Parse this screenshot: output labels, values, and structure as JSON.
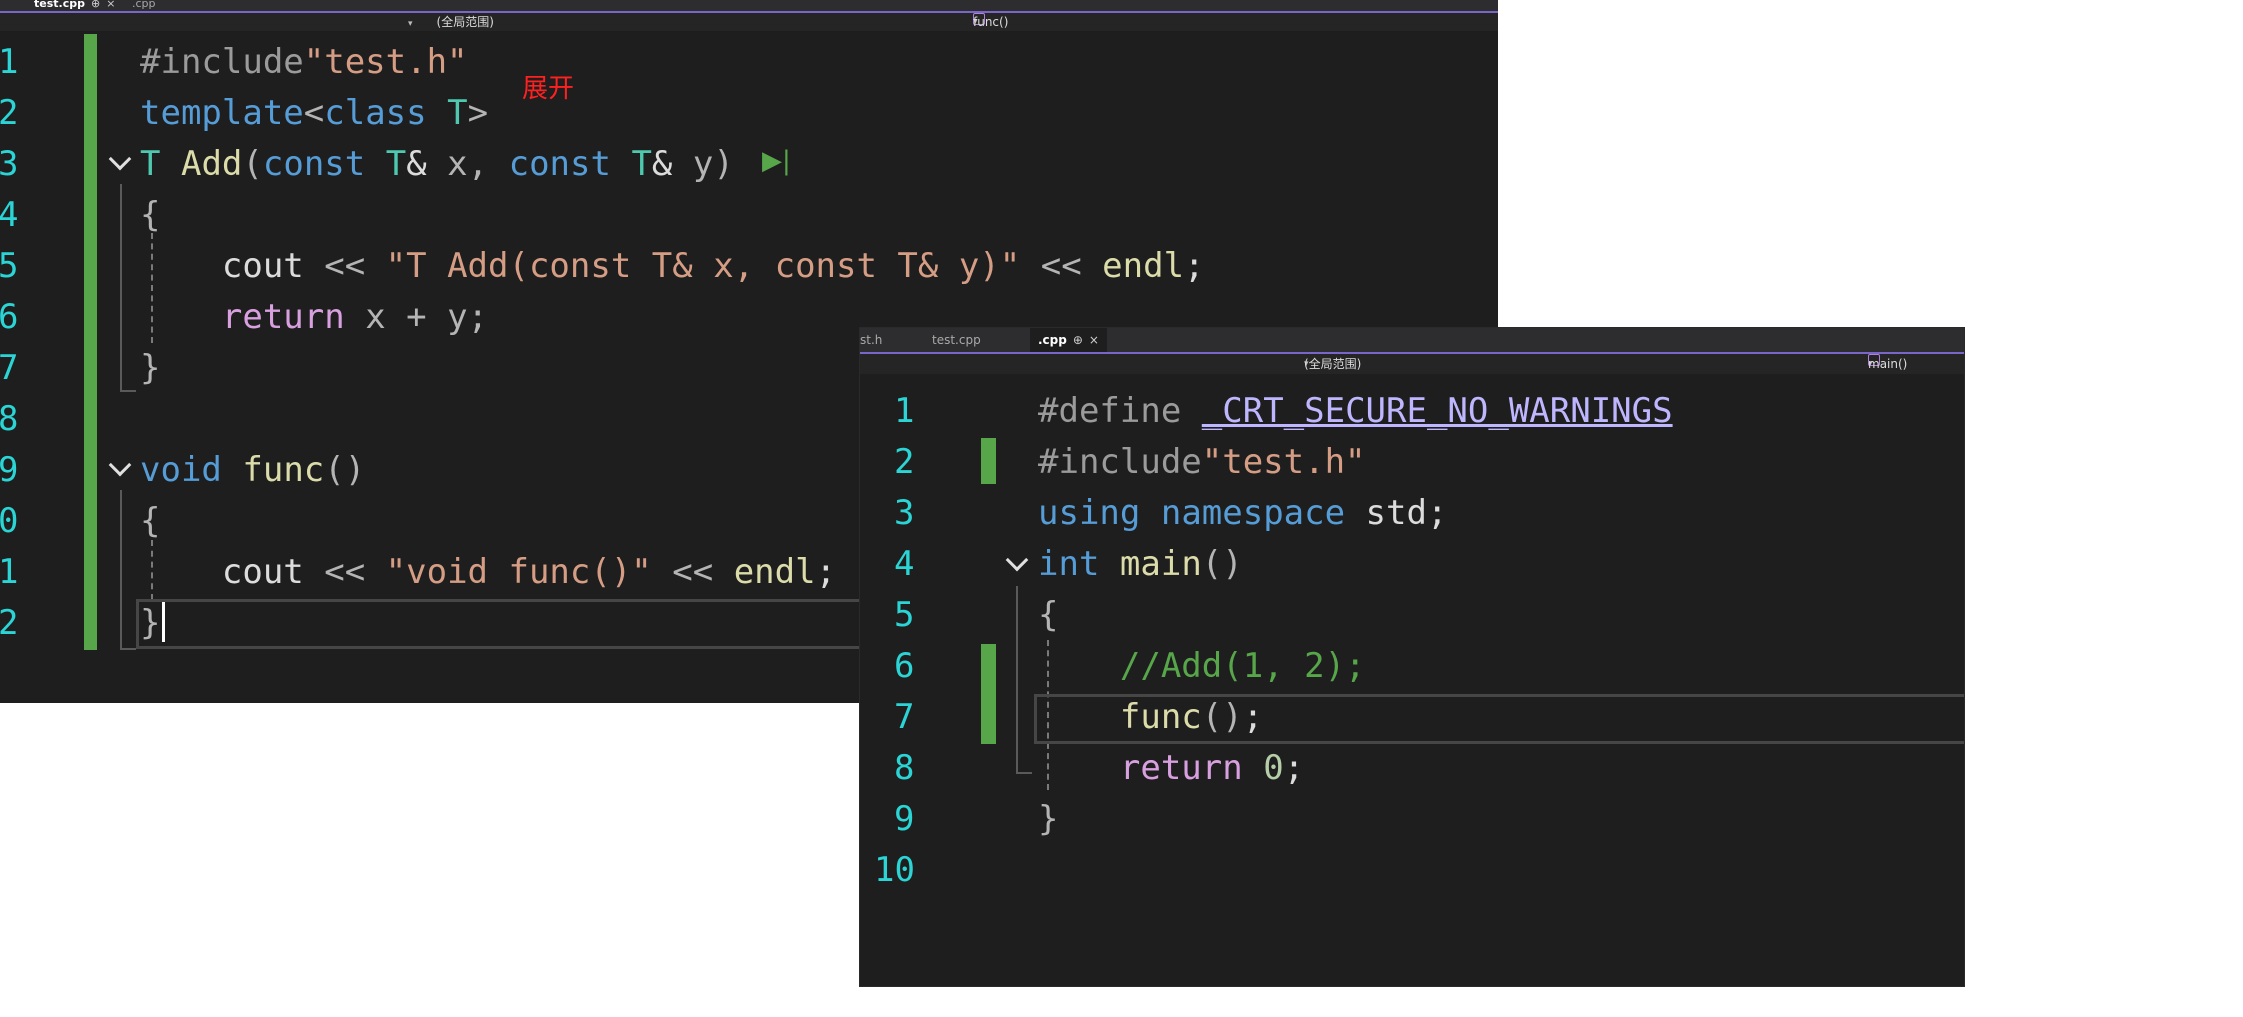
{
  "window1": {
    "tabs": [
      "test.cpp",
      ".cpp"
    ],
    "scope": "(全局范围)",
    "member": "func()",
    "annotation": "展开",
    "line_numbers": [
      "1",
      "2",
      "3",
      "4",
      "5",
      "6",
      "7",
      "8",
      "9",
      "0",
      "1",
      "2"
    ]
  },
  "window2": {
    "tabs": [
      "st.h",
      "test.cpp",
      ".cpp"
    ],
    "scope": "(全局范围)",
    "member": "main()",
    "line_numbers": [
      "1",
      "2",
      "3",
      "4",
      "5",
      "6",
      "7",
      "8",
      "9",
      "10"
    ]
  },
  "colors": {
    "editor_bg": "#1e1e1e",
    "keyword": "#569cd6",
    "type": "#4ec9b0",
    "function": "#dcdcaa",
    "string": "#d69d85",
    "control": "#d8a0df",
    "comment": "#57a64a",
    "line_number": "#2bd5d5",
    "change_marker": "#57a64a",
    "annotation": "#ff2020"
  }
}
